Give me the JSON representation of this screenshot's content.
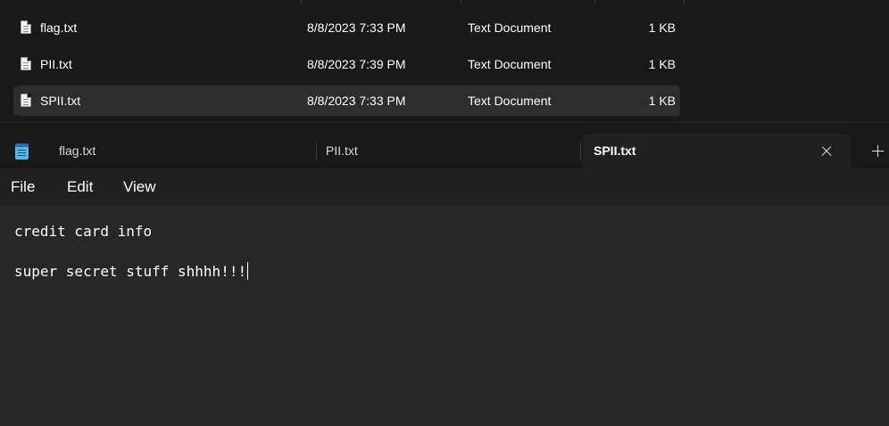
{
  "explorer": {
    "files": [
      {
        "name": "flag.txt",
        "date": "8/8/2023 7:33 PM",
        "type": "Text Document",
        "size": "1 KB",
        "selected": false
      },
      {
        "name": "PII.txt",
        "date": "8/8/2023 7:39 PM",
        "type": "Text Document",
        "size": "1 KB",
        "selected": false
      },
      {
        "name": "SPII.txt",
        "date": "8/8/2023 7:33 PM",
        "type": "Text Document",
        "size": "1 KB",
        "selected": true
      }
    ]
  },
  "notepad": {
    "tabs": [
      {
        "label": "flag.txt",
        "active": false
      },
      {
        "label": "PII.txt",
        "active": false
      },
      {
        "label": "SPII.txt",
        "active": true
      }
    ],
    "menu": {
      "file": "File",
      "edit": "Edit",
      "view": "View"
    },
    "content": {
      "line1": "credit card info",
      "line2": "super secret stuff shhhh!!!"
    }
  },
  "icons": {
    "file": "text-document-icon",
    "app": "notepad-icon",
    "close": "close-icon",
    "new_tab": "plus-icon"
  }
}
